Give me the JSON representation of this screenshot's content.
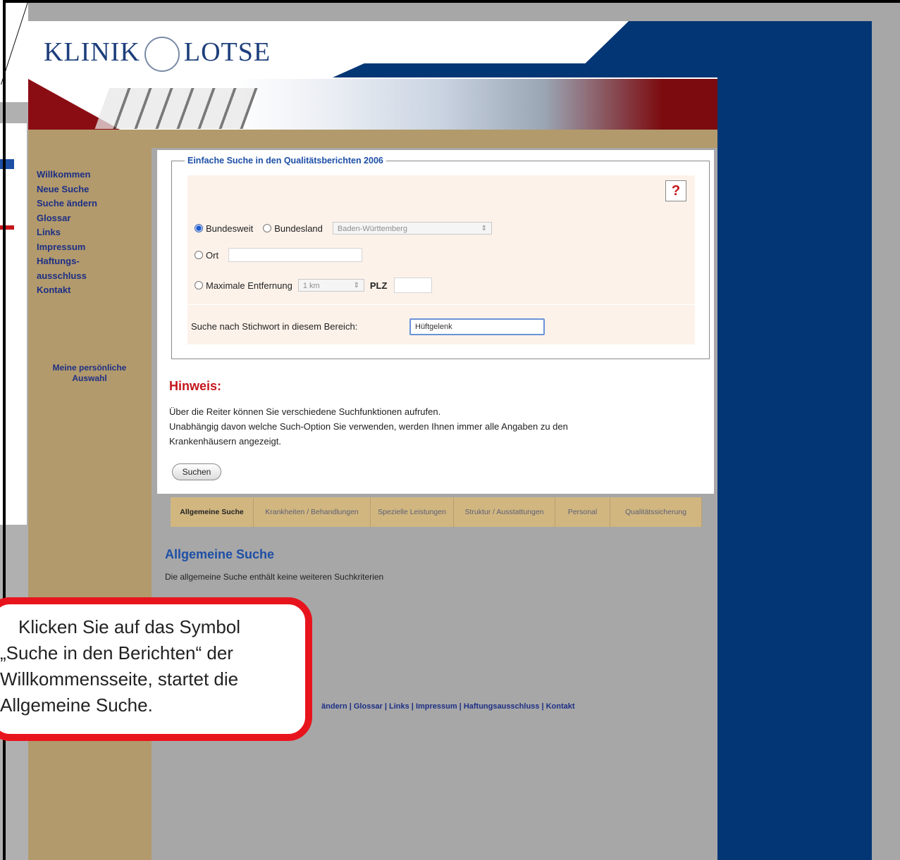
{
  "header": {
    "logo_left": "KLINIK",
    "logo_right": "LOTSE"
  },
  "nav": {
    "items": [
      {
        "label": "Willkommen"
      },
      {
        "label": "Neue Suche"
      },
      {
        "label": "Suche ändern"
      },
      {
        "label": "Glossar"
      },
      {
        "label": "Links"
      },
      {
        "label": "Impressum"
      },
      {
        "label": "Haftungs-"
      },
      {
        "label": "ausschluss"
      },
      {
        "label": "Kontakt"
      }
    ],
    "personal_line1": "Meine persönliche",
    "personal_line2": "Auswahl"
  },
  "form": {
    "legend": "Einfache Suche in den Qualitätsberichten 2006",
    "help_symbol": "?",
    "radio_bundesweit": "Bundesweit",
    "radio_bundesland": "Bundesland",
    "bundesland_selected": "Baden-Württemberg",
    "radio_ort": "Ort",
    "radio_entfernung": "Maximale Entfernung",
    "entfernung_selected": "1 km",
    "plz_label": "PLZ",
    "stichwort_label": "Suche nach Stichwort in diesem Bereich:",
    "stichwort_value": "Hüftgelenk"
  },
  "hint": {
    "title": "Hinweis:",
    "line1": "Über die Reiter können Sie verschiedene Suchfunktionen aufrufen.",
    "line2": "Unabhängig davon welche Such-Option Sie verwenden, werden Ihnen immer alle Angaben zu den",
    "line3": "Krankenhäusern angezeigt.",
    "button": "Suchen"
  },
  "tabs": [
    {
      "label": "Allgemeine Suche",
      "active": true
    },
    {
      "label": "Krankheiten / Behandlungen"
    },
    {
      "label": "Spezielle Leistungen"
    },
    {
      "label": "Struktur / Ausstattungen"
    },
    {
      "label": "Personal"
    },
    {
      "label": "Qualitätssicherung"
    }
  ],
  "section": {
    "title": "Allgemeine Suche",
    "text": "Die allgemeine Suche enthält keine weiteren Suchkriterien"
  },
  "footer": {
    "links": "ändern | Glossar | Links | Impressum | Haftungsausschluss | Kontakt"
  },
  "callout": {
    "line1": "Klicken Sie auf das Symbol",
    "line2": "„Suche in den Berichten“ der",
    "line3": "Willkommensseite, startet die",
    "line4": "Allgemeine Suche."
  },
  "colors": {
    "brand_blue": "#033674",
    "sidebar_tan": "#b29a6c",
    "hint_red": "#c4161c",
    "callout_red": "#e8141d"
  }
}
